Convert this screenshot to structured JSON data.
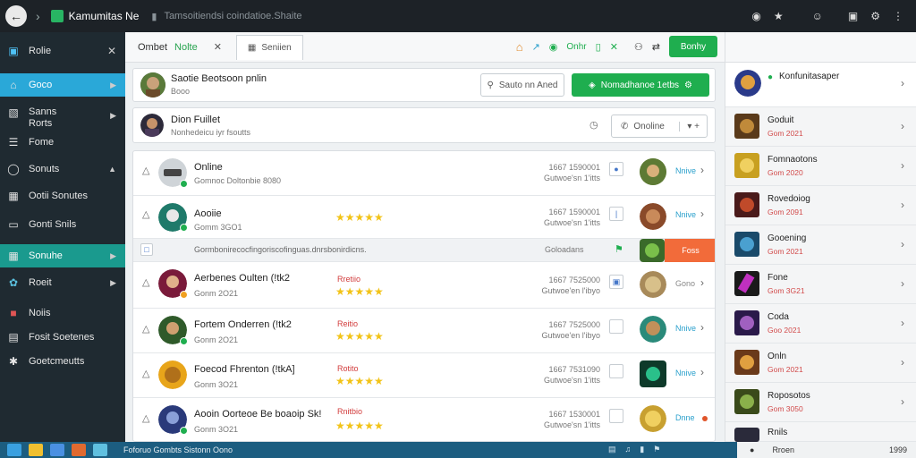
{
  "browser": {
    "tab_title": "Kamumitas Ne",
    "address": "Tamsoitiendsi coindatioe.Shaite",
    "icons": [
      "info-icon",
      "star-icon",
      "smiley-icon",
      "download-icon",
      "settings-icon",
      "menu-icon"
    ]
  },
  "sidebar": {
    "header": "Rolie",
    "items": [
      {
        "label": "Rolie"
      },
      {
        "label": "Goco"
      },
      {
        "label": "Sanns",
        "label2": "Rorts"
      },
      {
        "label": "Fome"
      },
      {
        "label": "Sonuts"
      },
      {
        "label": "Ootii Sonutes"
      },
      {
        "label": "Gonti Snils"
      },
      {
        "label": "Sonuhe"
      },
      {
        "label": "Roeit"
      },
      {
        "label": "Noiis"
      },
      {
        "label": "Fosit Soetenes"
      },
      {
        "label": "Goetcmeutts"
      }
    ]
  },
  "toolbar": {
    "tab1_label": "Ombet",
    "tab1_green": "Nolte",
    "tab2_label": "Seniien",
    "right_label": "Onhr",
    "right_button": "Bonhy"
  },
  "profile": {
    "name": "Saotie Beotsoon pnlin",
    "sub": "Booo",
    "search_placeholder": "Sauto nn Aned",
    "green_button": "Nomadhanoe 1etbs"
  },
  "online_bar": {
    "name": "Dion Fuillet",
    "sub": "Nonhedeicu iyr fsoutts",
    "button": "Onoline"
  },
  "rows": [
    {
      "name": "Online",
      "sub": "Gomnoc Doltonbie 8080",
      "tag": "",
      "stars": 0,
      "time1": "1667 1590001",
      "time2": "Gutwoe'sn 1'itts",
      "check": "●",
      "action": "Nnive"
    },
    {
      "name": "Aooiie",
      "sub": "Gomm 3GO1",
      "tag": "",
      "stars": 5,
      "time1": "1667 1590001",
      "time2": "Gutwoe'sn 1'itts",
      "check": "|",
      "action": "Nnive"
    },
    {
      "name": "Aerbenes Oulten (!tk2",
      "sub": "Gonm 2O21",
      "tag": "Rretiio",
      "stars": 5,
      "time1": "1667 7525000",
      "time2": "Gutwoe'en l'ibyo",
      "check": "▣",
      "action": "Gono"
    },
    {
      "name": "Fortem Onderren (!tk2",
      "sub": "Gonm 2O21",
      "tag": "Reitio",
      "stars": 5,
      "time1": "1667 7525000",
      "time2": "Gutwoe'en l'ibyo",
      "check": "",
      "action": "Nnive"
    },
    {
      "name": "Foecod Fhrenton (!tkA]",
      "sub": "Gonm 3O21",
      "tag": "Rotito",
      "stars": 5,
      "time1": "1667 7531090",
      "time2": "Gutwoe'sn 1'itts",
      "check": "",
      "action": "Nnive"
    },
    {
      "name": "Aooin Oorteoe Be boaoip Sk!",
      "sub": "Gonm 3O21",
      "tag": "Rnitbio",
      "stars": 5,
      "time1": "1667 1530001",
      "time2": "Gutwoe'sn 1'itts",
      "check": "",
      "action": "Dnne"
    }
  ],
  "notice": {
    "text": "Gormbonirecocfingoriscofinguas.dnrsbonirdicns.",
    "time": "Goloadans",
    "action": "Foss"
  },
  "right_panel": {
    "top_name": "Konfunitasaper",
    "items": [
      {
        "name": "Goduit",
        "sub": "Gom 2021"
      },
      {
        "name": "Fomnaotons",
        "sub": "Gom 2020"
      },
      {
        "name": "Rovedoiog",
        "sub": "Gom 2091"
      },
      {
        "name": "Gooening",
        "sub": "Gom 2021"
      },
      {
        "name": "Fone",
        "sub": "Gom 3G21"
      },
      {
        "name": "Coda",
        "sub": "Goo 2021"
      },
      {
        "name": "Onln",
        "sub": "Gom 2021"
      },
      {
        "name": "Roposotos",
        "sub": "Gom 3050"
      },
      {
        "name": "Rnils",
        "sub": ""
      }
    ]
  },
  "taskbar": {
    "text": "Foforuo Gombts Sistonn Oono",
    "tray_text": "Rroen",
    "clock": "1999"
  },
  "colors": {
    "green": "#1fae4f",
    "blue_active": "#2aa8d8",
    "teal_active": "#1a9a8e",
    "tag_red": "#d23c3c",
    "star": "#f2c318"
  }
}
